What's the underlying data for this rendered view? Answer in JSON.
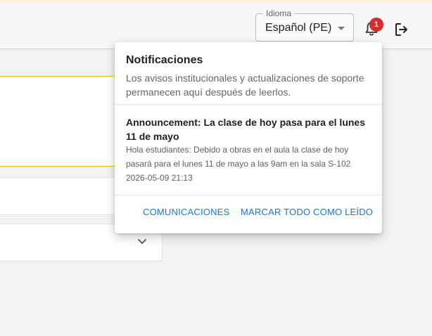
{
  "header": {
    "language_label": "Idioma",
    "language_value": "Español (PE)",
    "notification_count": "1",
    "icons": {
      "bell": "bell-icon",
      "logout": "logout-icon",
      "caret": "caret-down-icon"
    }
  },
  "background": {
    "select_icon": "chevron-down-icon"
  },
  "notifications": {
    "title": "Notificaciones",
    "subtitle": "Los avisos institucionales y actualizaciones de soporte permanecen aquí después de leerlos.",
    "items": [
      {
        "title": "Announcement: La clase de hoy pasa para el lunes 11 de mayo",
        "body": "Hola estudiantes: Debido a obras en el aula la clase de hoy pasará para el lunes 11 de mayo a las 9am en la sala S-102",
        "timestamp": "2026-05-09 21:13"
      }
    ],
    "actions": {
      "communications": "COMUNICACIONES",
      "mark_all_read": "MARCAR TODO COMO LEÍDO"
    }
  },
  "colors": {
    "accent": "#1976d2",
    "badge": "#d32f2f",
    "highlight_border": "#f0b429"
  }
}
